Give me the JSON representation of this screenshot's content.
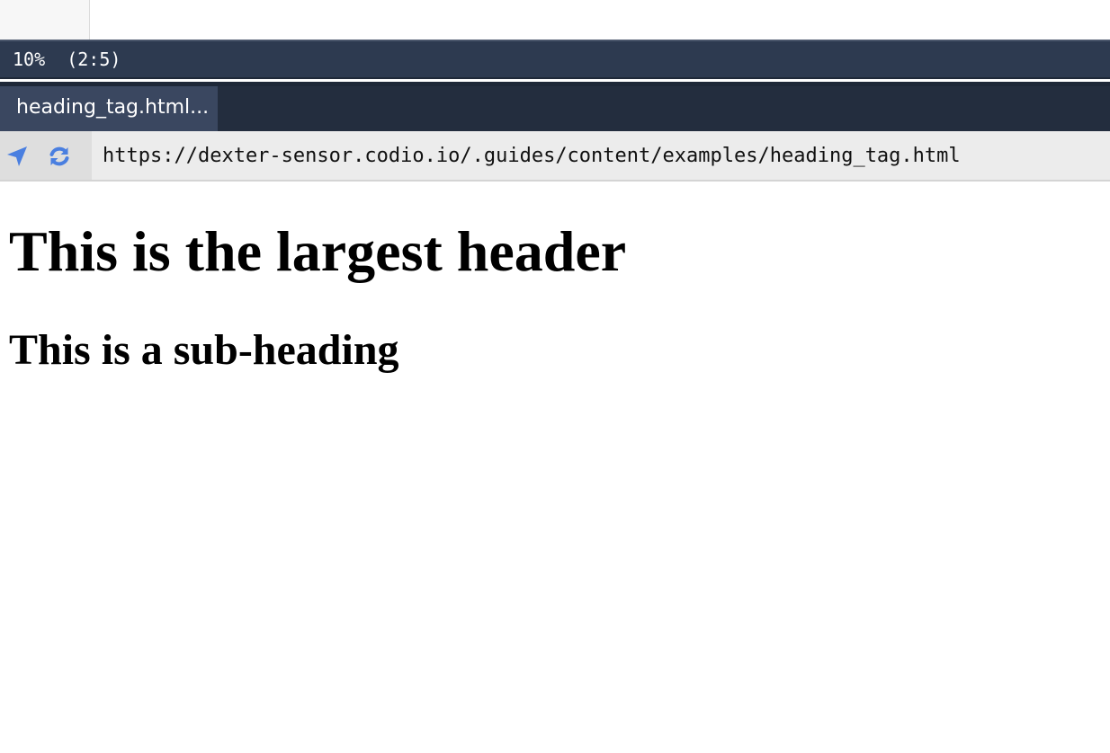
{
  "status_bar": {
    "percent": "10%",
    "position": "(2:5)"
  },
  "tab": {
    "label": "heading_tag.html..."
  },
  "address_bar": {
    "locate_icon": "location-arrow-icon",
    "refresh_icon": "refresh-icon",
    "url": "https://dexter-sensor.codio.io/.guides/content/examples/heading_tag.html",
    "icon_color": "#4a7fe0"
  },
  "page": {
    "heading1": "This is the largest header",
    "heading2": "This is a sub-heading"
  }
}
